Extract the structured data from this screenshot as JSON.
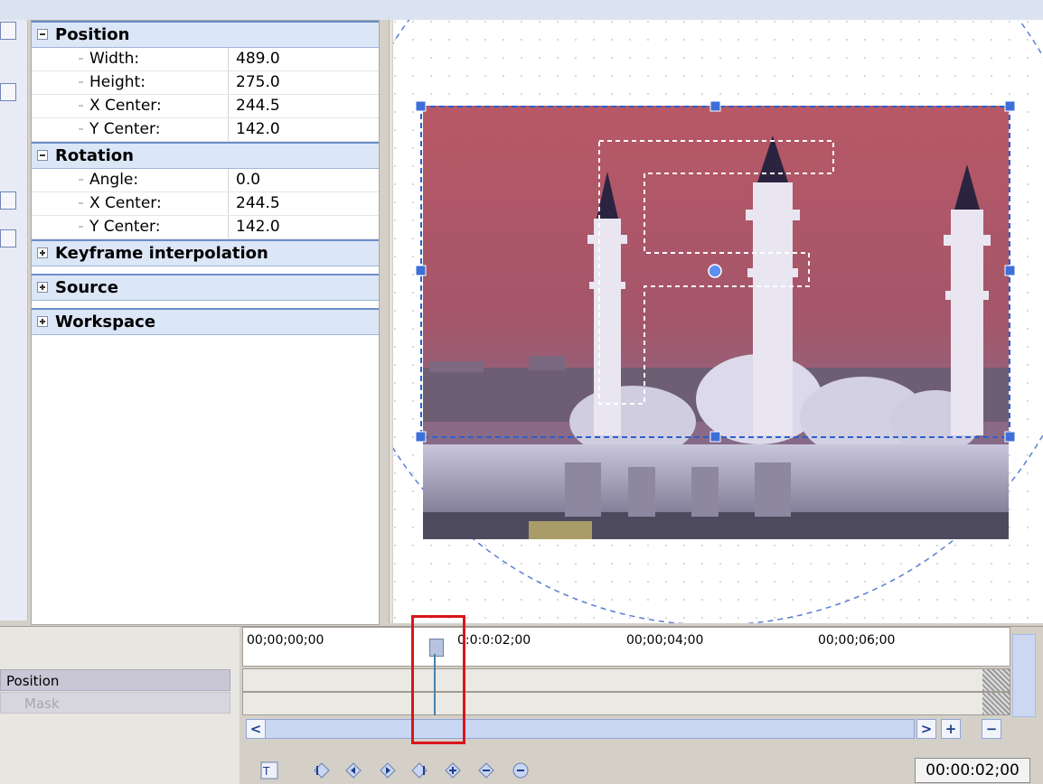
{
  "properties": {
    "position": {
      "title": "Position",
      "rows": [
        {
          "label": "Width:",
          "value": "489.0"
        },
        {
          "label": "Height:",
          "value": "275.0"
        },
        {
          "label": "X Center:",
          "value": "244.5"
        },
        {
          "label": "Y Center:",
          "value": "142.0"
        }
      ]
    },
    "rotation": {
      "title": "Rotation",
      "rows": [
        {
          "label": "Angle:",
          "value": "0.0"
        },
        {
          "label": "X Center:",
          "value": "244.5"
        },
        {
          "label": "Y Center:",
          "value": "142.0"
        }
      ]
    },
    "collapsed": [
      "Keyframe interpolation",
      "Source",
      "Workspace"
    ]
  },
  "timeline": {
    "ruler": [
      "00;00;00;00",
      "00;00;02;00",
      "00;00;04;00",
      "00;00;06;00"
    ],
    "ruler_partial": "0:0:0:02;00",
    "tracks": [
      "Position",
      "Mask"
    ],
    "scroll_left": "<",
    "scroll_right": ">",
    "zoom_in": "+",
    "zoom_out": "−",
    "timecode": "00:00:02;00"
  },
  "colors": {
    "section_bg": "#dbe6f7",
    "selection": "#3366cc",
    "highlight": "#d9151b"
  },
  "icons": [
    "sync-cursor-icon",
    "first-keyframe-icon",
    "prev-keyframe-icon",
    "next-keyframe-icon",
    "last-keyframe-icon",
    "add-keyframe-icon",
    "delete-keyframe-icon"
  ]
}
